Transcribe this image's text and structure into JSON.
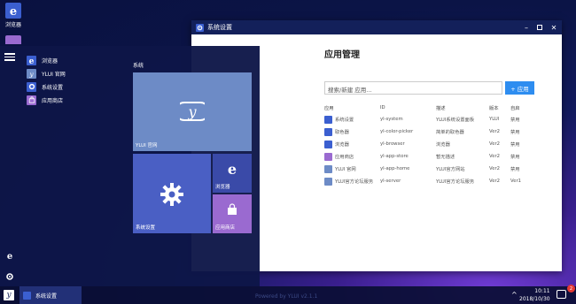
{
  "colors": {
    "accent": "#2e8df0",
    "window_titlebar": "#13205a",
    "tile_ylui": "#6d8bc6",
    "tile_settings": "#4a5fc4",
    "tile_browser": "#3a4aa8",
    "tile_store": "#9a6ad0"
  },
  "desktop": {
    "icons": [
      {
        "label": "浏览器",
        "icon": "browser-e-icon"
      },
      {
        "label": "",
        "icon": "store-bag-icon"
      }
    ]
  },
  "window": {
    "title": "系统设置",
    "heading": "应用管理",
    "search_placeholder": "搜索/新建 应用...",
    "add_button": "+ 应用",
    "columns": [
      "应用",
      "ID",
      "描述",
      "版本",
      "自启"
    ],
    "rows": [
      {
        "name": "系统设置",
        "id": "yl-system",
        "desc": "YLUI系统设置面板",
        "version": "YLUI",
        "autostart": "禁用",
        "color": "#3b5fd0",
        "icon": "gear-icon"
      },
      {
        "name": "取色器",
        "id": "yl-color-picker",
        "desc": "简单的取色器",
        "version": "Ver2",
        "autostart": "禁用",
        "color": "#3b5fd0",
        "icon": "eyedropper-icon"
      },
      {
        "name": "浏览器",
        "id": "yl-browser",
        "desc": "浏览器",
        "version": "Ver2",
        "autostart": "禁用",
        "color": "#3b5fd0",
        "icon": "browser-e-icon"
      },
      {
        "name": "应用商店",
        "id": "yl-app-store",
        "desc": "暂无描述",
        "version": "Ver2",
        "autostart": "禁用",
        "color": "#9a6ad0",
        "icon": "store-bag-icon"
      },
      {
        "name": "YLUI 官网",
        "id": "yl-app-home",
        "desc": "YLUI官方网站",
        "version": "Ver2",
        "autostart": "禁用",
        "color": "#6d8bc6",
        "icon": "ylui-logo-icon"
      },
      {
        "name": "YLUI官方论坛服务",
        "id": "yl-server",
        "desc": "YLUI官方论坛服务",
        "version": "Ver2",
        "autostart": "Ver1",
        "color": "#6d8bc6",
        "icon": "ylui-logo-icon"
      }
    ]
  },
  "start_menu": {
    "items": [
      {
        "label": "浏览器",
        "icon": "browser-e-icon"
      },
      {
        "label": "YLUI 官网",
        "icon": "ylui-logo-icon"
      },
      {
        "label": "系统设置",
        "icon": "gear-icon"
      },
      {
        "label": "应用商店",
        "icon": "store-bag-icon"
      }
    ],
    "group_title": "系统",
    "tiles": {
      "ylui": "YLUI 官网",
      "settings": "系统设置",
      "browser": "浏览器",
      "store": "应用商店"
    }
  },
  "taskbar": {
    "active_task": "系统设置",
    "powered_by": "Powered by YLUI v2.1.1",
    "time": "10:11",
    "date": "2018/10/30",
    "notification_count": "2"
  }
}
